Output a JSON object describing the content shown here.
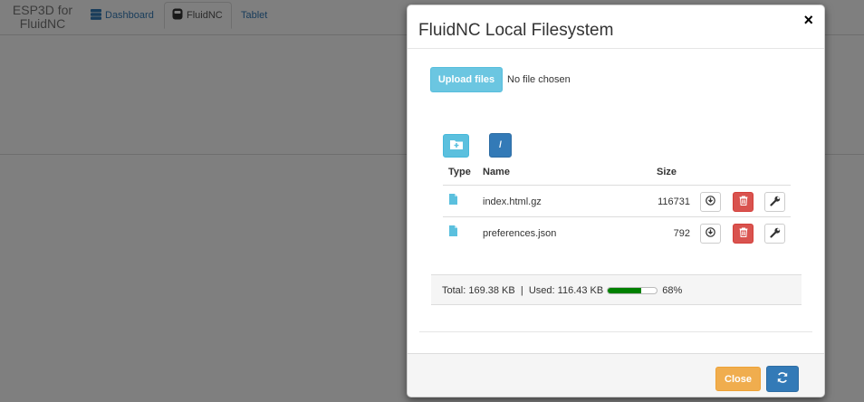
{
  "app": {
    "brand_line1": "ESP3D for",
    "brand_line2": "FluidNC",
    "tabs": [
      {
        "label": "Dashboard",
        "icon": "server-icon"
      },
      {
        "label": "FluidNC",
        "icon": "cnc-icon",
        "active": true
      },
      {
        "label": "Tablet"
      }
    ]
  },
  "modal": {
    "title": "FluidNC Local Filesystem",
    "close_glyph": "×",
    "upload_label": "Upload files",
    "no_file_text": "No file chosen",
    "path_label": "/",
    "columns": {
      "type": "Type",
      "name": "Name",
      "size": "Size"
    },
    "files": [
      {
        "name": "index.html.gz",
        "size": "116731",
        "icon": "file-icon"
      },
      {
        "name": "preferences.json",
        "size": "792",
        "icon": "file-icon"
      }
    ],
    "usage": {
      "total_label": "Total:",
      "total_value": "169.38 KB",
      "separator": "|",
      "used_label": "Used:",
      "used_value": "116.43 KB",
      "percent_text": "68%",
      "percent": 68
    },
    "close_label": "Close"
  },
  "colors": {
    "info": "#5bc0de",
    "primary": "#337ab7",
    "danger": "#d9534f",
    "warning": "#f0ad4e",
    "progress": "#008000"
  }
}
